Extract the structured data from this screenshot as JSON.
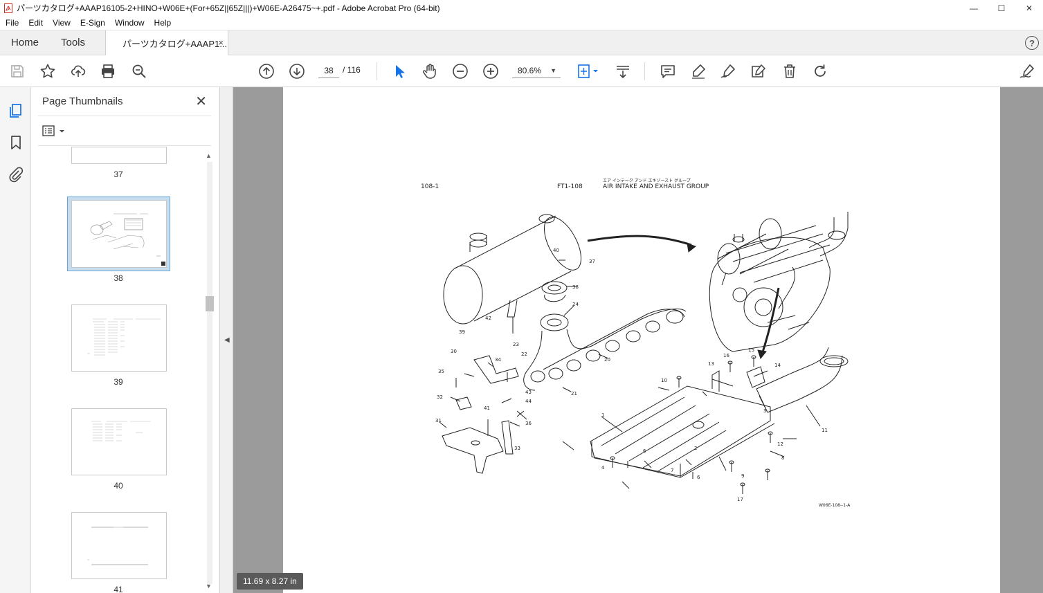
{
  "window": {
    "title": "パーツカタログ+AAAP16105-2+HINO+W06E+(For+65Z||65Z|||)+W06E-A26475~+.pdf - Adobe Acrobat Pro (64-bit)",
    "minimize": "—",
    "maximize": "☐",
    "close": "✕",
    "accent": "#d7281b"
  },
  "menu": [
    "File",
    "Edit",
    "View",
    "E-Sign",
    "Window",
    "Help"
  ],
  "tabs": {
    "home": "Home",
    "tools": "Tools",
    "document": "パーツカタログ+AAAP1...",
    "close": "×",
    "help": "?"
  },
  "toolbar": {
    "page_current": "38",
    "page_of": "/  116",
    "zoom": "80.6%",
    "zoom_caret": "▼",
    "icons": [
      "save-icon",
      "star-icon",
      "share-upload-icon",
      "print-icon",
      "find-zoom-icon",
      "prev-page-icon",
      "next-page-icon",
      "select-arrow-icon",
      "hand-icon",
      "zoom-out-icon",
      "zoom-in-icon",
      "page-fit-icon",
      "scroll-mode-icon",
      "comment-icon",
      "highlight-pen-icon",
      "sign-pen-icon",
      "edit-tag-icon",
      "trash-icon",
      "rotate-icon",
      "fill-sign-icon"
    ],
    "accent": "#1473e6"
  },
  "panel": {
    "title": "Page Thumbnails",
    "close": "✕",
    "thumbnails": [
      {
        "label": "37"
      },
      {
        "label": "38",
        "selected": true
      },
      {
        "label": "39"
      },
      {
        "label": "40"
      },
      {
        "label": "41"
      }
    ]
  },
  "document": {
    "page_ref": "108-1",
    "group_code": "FT1-108",
    "title_jp": "エア インテーク アンド エキゾースト グループ",
    "title_en": "AIR INTAKE AND EXHAUST GROUP",
    "figure_code": "W06E-108--1-A",
    "part_numbers": [
      "1",
      "2",
      "3",
      "4",
      "6",
      "6",
      "7",
      "8",
      "9",
      "10",
      "11",
      "12",
      "13",
      "14",
      "15",
      "16",
      "17",
      "20",
      "21",
      "22",
      "23",
      "24",
      "30",
      "31",
      "32",
      "33",
      "34",
      "35",
      "36",
      "37",
      "38",
      "39",
      "40",
      "41",
      "42",
      "43",
      "44"
    ]
  },
  "status": {
    "page_size": "11.69 x 8.27 in"
  }
}
